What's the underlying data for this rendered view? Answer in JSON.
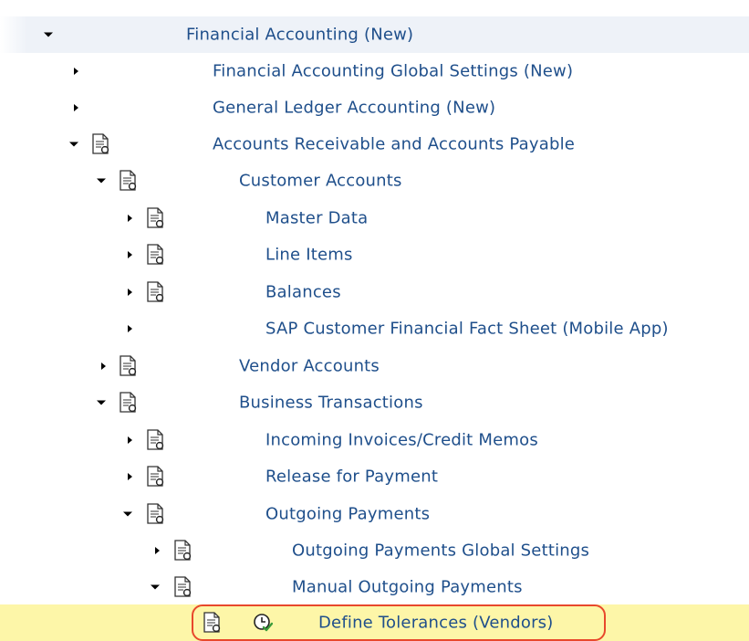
{
  "tree": {
    "items": [
      {
        "label": "Financial Accounting (New)",
        "expanded": true,
        "icon": "none"
      },
      {
        "label": "Financial Accounting Global Settings (New)",
        "expanded": false,
        "icon": "none"
      },
      {
        "label": "General Ledger Accounting (New)",
        "expanded": false,
        "icon": "none"
      },
      {
        "label": "Accounts Receivable and Accounts Payable",
        "expanded": true,
        "icon": "document-icon"
      },
      {
        "label": "Customer Accounts",
        "expanded": true,
        "icon": "document-icon"
      },
      {
        "label": "Master Data",
        "expanded": false,
        "icon": "document-icon"
      },
      {
        "label": "Line Items",
        "expanded": false,
        "icon": "document-icon"
      },
      {
        "label": "Balances",
        "expanded": false,
        "icon": "document-icon"
      },
      {
        "label": "SAP Customer Financial Fact Sheet (Mobile App)",
        "expanded": false,
        "icon": "none"
      },
      {
        "label": "Vendor Accounts",
        "expanded": false,
        "icon": "document-icon"
      },
      {
        "label": "Business Transactions",
        "expanded": true,
        "icon": "document-icon"
      },
      {
        "label": "Incoming Invoices/Credit Memos",
        "expanded": false,
        "icon": "document-icon"
      },
      {
        "label": "Release for Payment",
        "expanded": false,
        "icon": "document-icon"
      },
      {
        "label": "Outgoing Payments",
        "expanded": true,
        "icon": "document-icon"
      },
      {
        "label": "Outgoing Payments Global Settings",
        "expanded": false,
        "icon": "document-icon"
      },
      {
        "label": "Manual Outgoing Payments",
        "expanded": true,
        "icon": "document-icon"
      },
      {
        "label": "Define Tolerances (Vendors)",
        "expanded": null,
        "icon": "document-icon",
        "extra_icon": "execute-clock-icon",
        "selected": true
      }
    ]
  },
  "colors": {
    "link_text": "#1f4f8b",
    "selected_row": "#fdf6a8",
    "top_row": "#eef2f8",
    "highlight_border": "#e8482c"
  }
}
